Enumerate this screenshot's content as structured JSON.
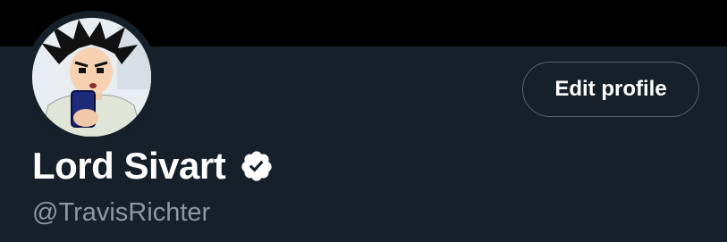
{
  "profile": {
    "display_name": "Lord Sivart",
    "handle": "@TravisRichter",
    "verified": true
  },
  "actions": {
    "edit_profile_label": "Edit profile"
  },
  "icons": {
    "verified": "verified-badge-icon",
    "avatar": "profile-avatar"
  },
  "colors": {
    "background": "#15202b",
    "banner": "#000000",
    "primary_text": "#ffffff",
    "secondary_text": "#8b98a5",
    "button_border": "#536471"
  }
}
